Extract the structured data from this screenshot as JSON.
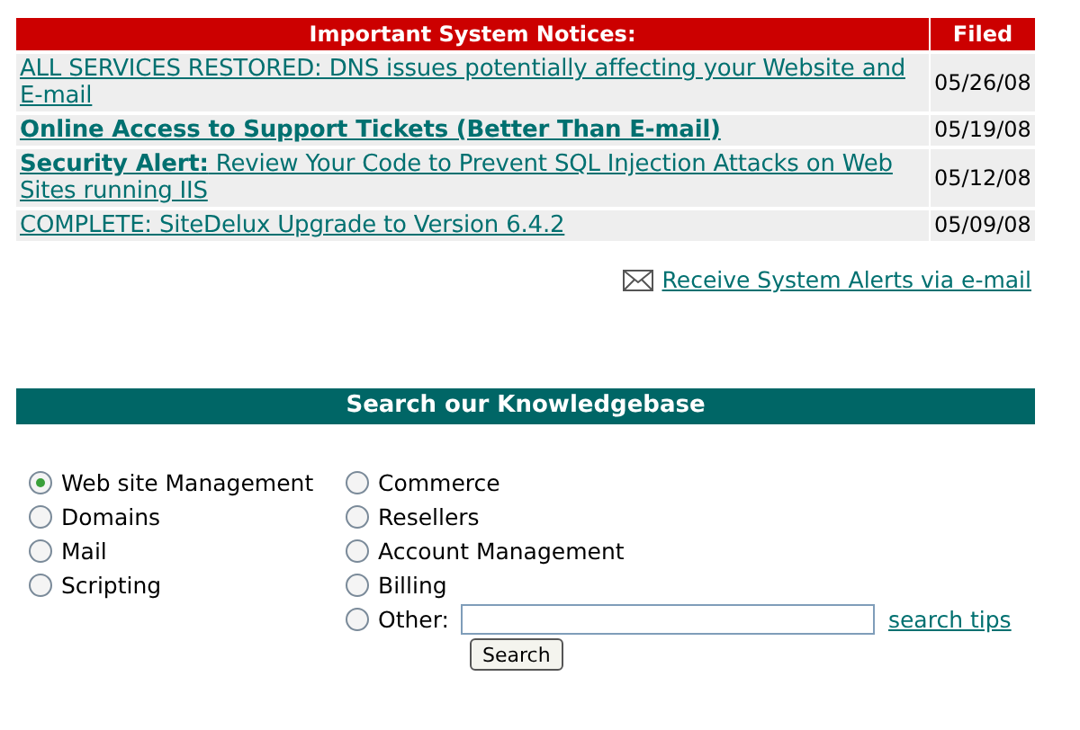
{
  "notices": {
    "columns": [
      "Important System Notices:",
      "Filed"
    ],
    "rows": [
      {
        "title": "ALL SERVICES RESTORED: DNS issues potentially affecting your Website and E-mail",
        "bold": false,
        "filed": "05/26/08"
      },
      {
        "title": "Online Access to Support Tickets (Better Than E-mail)",
        "bold": true,
        "filed": "05/19/08"
      },
      {
        "title": "**Security Alert:** Review Your Code to Prevent SQL Injection Attacks on Web Sites running IIS",
        "bold": false,
        "filed": "05/12/08"
      },
      {
        "title": "COMPLETE: SiteDelux Upgrade to Version 6.4.2",
        "bold": false,
        "filed": "05/09/08"
      }
    ]
  },
  "alerts_link": "Receive System Alerts via e-mail",
  "search": {
    "title": "Search our Knowledgebase",
    "columns": [
      [
        {
          "kind": "plain",
          "label": "Web site Management",
          "selected": true
        },
        {
          "kind": "plain",
          "label": "Domains",
          "selected": false
        },
        {
          "kind": "plain",
          "label": "Mail",
          "selected": false
        },
        {
          "kind": "plain",
          "label": "Scripting",
          "selected": false
        }
      ],
      [
        {
          "kind": "plain",
          "label": "Commerce",
          "selected": false
        },
        {
          "kind": "plain",
          "label": "Resellers",
          "selected": false
        },
        {
          "kind": "plain",
          "label": "Account Management",
          "selected": false
        },
        {
          "kind": "plain",
          "label": "Billing",
          "selected": false
        },
        {
          "kind": "other",
          "label": "Other:",
          "selected": false,
          "tips": "search tips"
        }
      ]
    ],
    "button": "Search"
  }
}
